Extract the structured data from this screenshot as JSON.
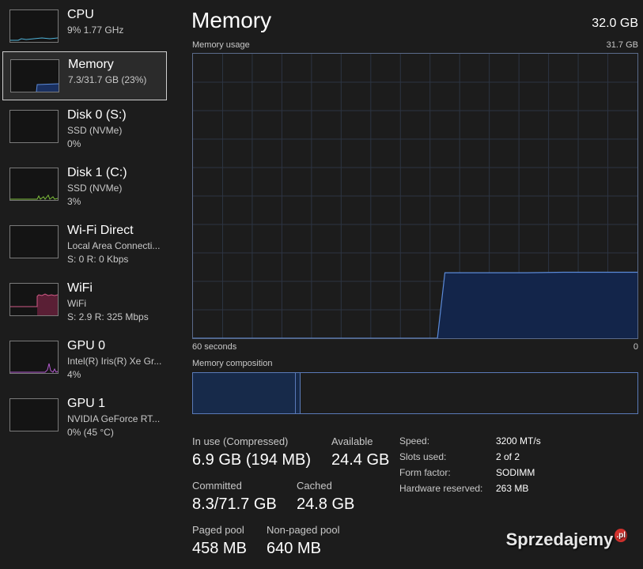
{
  "sidebar": {
    "items": [
      {
        "title": "CPU",
        "sub1": "9% 1.77 GHz",
        "sub2": ""
      },
      {
        "title": "Memory",
        "sub1": "7.3/31.7 GB (23%)",
        "sub2": ""
      },
      {
        "title": "Disk 0 (S:)",
        "sub1": "SSD (NVMe)",
        "sub2": "0%"
      },
      {
        "title": "Disk 1 (C:)",
        "sub1": "SSD (NVMe)",
        "sub2": "3%"
      },
      {
        "title": "Wi-Fi Direct",
        "sub1": "Local Area Connecti...",
        "sub2": "S: 0 R: 0 Kbps"
      },
      {
        "title": "WiFi",
        "sub1": "WiFi",
        "sub2": "S: 2.9 R: 325 Mbps"
      },
      {
        "title": "GPU 0",
        "sub1": "Intel(R) Iris(R) Xe Gr...",
        "sub2": "4%"
      },
      {
        "title": "GPU 1",
        "sub1": "NVIDIA GeForce RT...",
        "sub2": "0% (45 °C)"
      }
    ],
    "colors": {
      "cpu": "#4fb3d9",
      "memory": "#5b8ad8",
      "disk": "#7dbd3a",
      "wifi": "#d05a86",
      "gpu": "#b45ad0"
    }
  },
  "header": {
    "title": "Memory",
    "total": "32.0 GB"
  },
  "graph": {
    "usage_label": "Memory usage",
    "max_label": "31.7 GB",
    "time_label": "60 seconds",
    "zero_label": "0",
    "composition_label": "Memory composition",
    "in_use_fraction": 0.23,
    "modified_fraction": 0.012
  },
  "chart_data": {
    "type": "area",
    "title": "Memory usage",
    "xlabel": "60 seconds",
    "ylabel": "",
    "xlim": [
      60,
      0
    ],
    "ylim": [
      0,
      31.7
    ],
    "x": [
      60,
      27,
      26,
      25,
      20,
      15,
      10,
      5,
      0
    ],
    "values": [
      0,
      0,
      7.3,
      7.3,
      7.3,
      7.3,
      7.35,
      7.35,
      7.35
    ],
    "grid": true
  },
  "stats": {
    "in_use_label": "In use (Compressed)",
    "in_use_value": "6.9 GB (194 MB)",
    "available_label": "Available",
    "available_value": "24.4 GB",
    "committed_label": "Committed",
    "committed_value": "8.3/71.7 GB",
    "cached_label": "Cached",
    "cached_value": "24.8 GB",
    "paged_label": "Paged pool",
    "paged_value": "458 MB",
    "nonpaged_label": "Non-paged pool",
    "nonpaged_value": "640 MB"
  },
  "specs": {
    "speed_label": "Speed:",
    "speed_value": "3200 MT/s",
    "slots_label": "Slots used:",
    "slots_value": "2 of 2",
    "form_label": "Form factor:",
    "form_value": "SODIMM",
    "reserved_label": "Hardware reserved:",
    "reserved_value": "263 MB"
  },
  "watermark": {
    "text": "Sprzedajemy",
    "suffix": ".pl"
  }
}
